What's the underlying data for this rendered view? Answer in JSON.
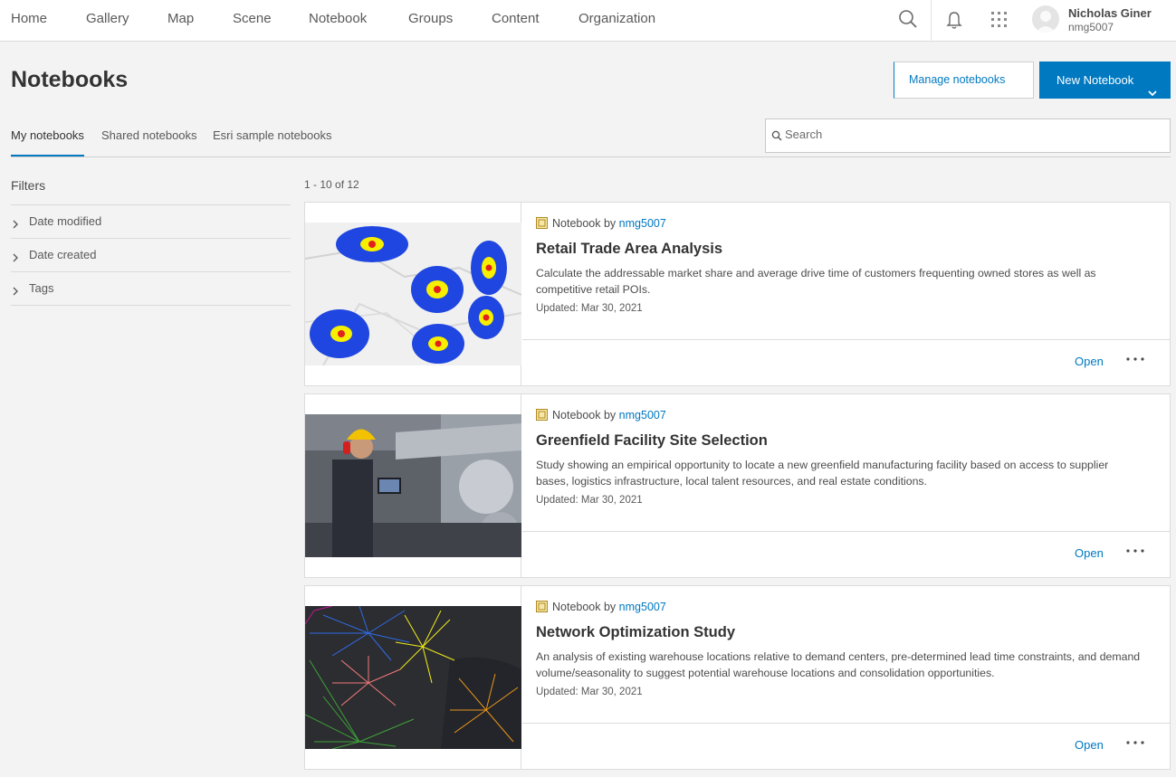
{
  "nav": {
    "items": [
      "Home",
      "Gallery",
      "Map",
      "Scene",
      "Notebook",
      "Groups",
      "Content",
      "Organization"
    ],
    "icons": [
      "search-icon",
      "bell-icon",
      "app-grid-icon"
    ],
    "user": {
      "name": "Nicholas Giner",
      "username": "nmg5007"
    }
  },
  "header": {
    "title": "Notebooks",
    "manage_label": "Manage notebooks",
    "new_label": "New Notebook"
  },
  "tabs": [
    {
      "label": "My notebooks",
      "active": true
    },
    {
      "label": "Shared notebooks",
      "active": false
    },
    {
      "label": "Esri sample notebooks",
      "active": false
    }
  ],
  "search": {
    "placeholder": "Search",
    "value": ""
  },
  "filters": {
    "title": "Filters",
    "items": [
      "Date modified",
      "Date created",
      "Tags"
    ]
  },
  "results": {
    "count_text": "1 - 10 of 12"
  },
  "cards": [
    {
      "type_prefix": "Notebook by",
      "owner": "nmg5007",
      "title": "Retail Trade Area Analysis",
      "description": "Calculate the addressable market share and average drive time of customers frequenting owned stores as well as competitive retail POIs.",
      "updated": "Updated: Mar 30, 2021",
      "open_label": "Open"
    },
    {
      "type_prefix": "Notebook by",
      "owner": "nmg5007",
      "title": "Greenfield Facility Site Selection",
      "description": "Study showing an empirical opportunity to locate a new greenfield manufacturing facility based on access to supplier bases, logistics infrastructure, local talent resources, and real estate conditions.",
      "updated": "Updated: Mar 30, 2021",
      "open_label": "Open"
    },
    {
      "type_prefix": "Notebook by",
      "owner": "nmg5007",
      "title": "Network Optimization Study",
      "description": "An analysis of existing warehouse locations relative to demand centers, pre-determined lead time constraints, and demand volume/seasonality to suggest potential warehouse locations and consolidation opportunities.",
      "updated": "Updated: Mar 30, 2021",
      "open_label": "Open"
    }
  ],
  "colors": {
    "accent": "#0079c1",
    "background": "#f3f3f3"
  }
}
